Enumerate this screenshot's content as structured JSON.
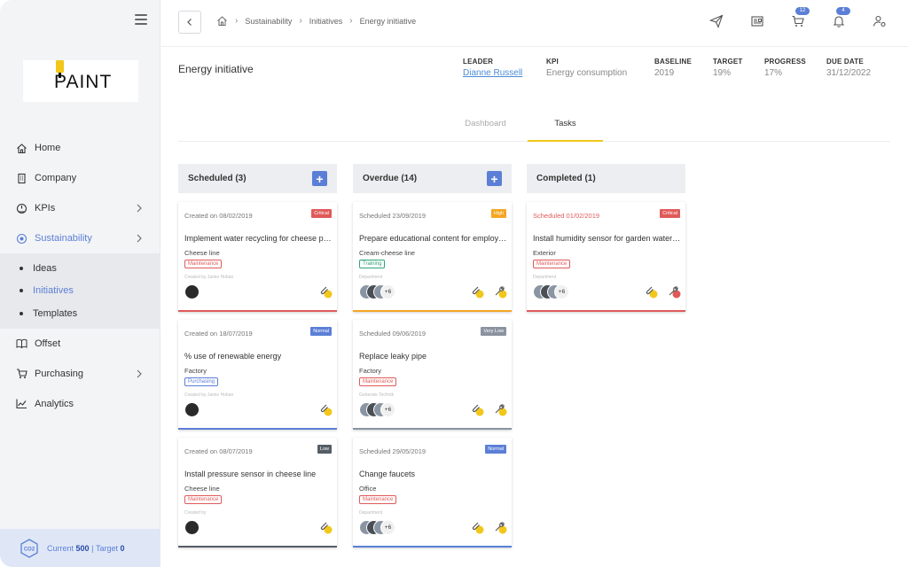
{
  "sidebar": {
    "logo": "PAINT",
    "items": [
      {
        "label": "Home",
        "icon": "home-icon"
      },
      {
        "label": "Company",
        "icon": "building-icon"
      },
      {
        "label": "KPIs",
        "icon": "gauge-icon"
      },
      {
        "label": "Sustainability",
        "icon": "globe-icon"
      },
      {
        "label": "Offset",
        "icon": "book-icon"
      },
      {
        "label": "Purchasing",
        "icon": "cart-icon"
      },
      {
        "label": "Analytics",
        "icon": "chart-icon"
      }
    ],
    "sub_items": [
      {
        "label": "Ideas"
      },
      {
        "label": "Initiatives"
      },
      {
        "label": "Templates"
      }
    ],
    "co2": {
      "icon_text": "CO2",
      "current_label": "Current",
      "current_value": "500",
      "separator": "|",
      "target_label": "Target",
      "target_value": "0"
    }
  },
  "breadcrumb": [
    "Sustainability",
    "Initiatives",
    "Energy initiative"
  ],
  "top_icons": {
    "cart_badge": "12",
    "bell_badge": "4"
  },
  "header": {
    "title": "Energy initiative",
    "leader_label": "LEADER",
    "leader_value": "Dianne Russell",
    "kpi_label": "KPI",
    "kpi_value": "Energy consumption",
    "baseline_label": "BASELINE",
    "baseline_value": "2019",
    "target_label": "TARGET",
    "target_value": "19%",
    "progress_label": "PROGRESS",
    "progress_value": "17%",
    "due_label": "DUE DATE",
    "due_value": "31/12/2022"
  },
  "tabs": {
    "dashboard": "Dashboard",
    "tasks": "Tasks"
  },
  "columns": [
    {
      "title": "Scheduled (3)",
      "add": "+",
      "cards": [
        {
          "date": "Created on 08/02/2019",
          "priority": "Critical",
          "title": "Implement water recycling for cheese production",
          "location": "Cheese line",
          "tag": "Maintenance",
          "meta": "Created by Jamie Hoban",
          "plus": ""
        },
        {
          "date": "Created on 18/07/2019",
          "priority": "Normal",
          "title": "% use of renewable energy",
          "location": "Factory",
          "tag": "Purchasing",
          "meta": "Created by Jamie Hoban",
          "plus": ""
        },
        {
          "date": "Created on 08/07/2019",
          "priority": "Low",
          "title": "Install pressure sensor in cheese line",
          "location": "Cheese line",
          "tag": "Maintenance",
          "meta": "Created by",
          "plus": ""
        }
      ]
    },
    {
      "title": "Overdue (14)",
      "add": "+",
      "cards": [
        {
          "date": "Scheduled 23/09/2019",
          "priority": "High",
          "title": "Prepare educational content for employees",
          "location": "Cream-cheese line",
          "tag": "Training",
          "meta": "Department",
          "plus": "+6"
        },
        {
          "date": "Scheduled 09/06/2019",
          "priority": "Very Low",
          "title": "Replace leaky pipe",
          "location": "Factory",
          "tag": "Maintenance",
          "meta": "Geberate Technik",
          "plus": "+6"
        },
        {
          "date": "Scheduled 29/05/2019",
          "priority": "Normal",
          "title": "Change faucets",
          "location": "Office",
          "tag": "Maintenance",
          "meta": "Department",
          "plus": "+6"
        }
      ]
    },
    {
      "title": "Completed (1)",
      "add": "",
      "cards": [
        {
          "date": "Scheduled 01/02/2019",
          "priority": "Critical",
          "title": "Install humidity sensor for garden watering",
          "location": "Exterior",
          "tag": "Maintenance",
          "meta": "Department",
          "plus": "+6"
        }
      ]
    }
  ],
  "colors": {
    "accent": "#5b7fd6",
    "yellow": "#f2c71b",
    "critical": "#e05a5a",
    "high": "#f5a623",
    "normal": "#5b7fd6",
    "low": "#555d66",
    "verylow": "#8a93a0",
    "training": "#2fa57a"
  }
}
